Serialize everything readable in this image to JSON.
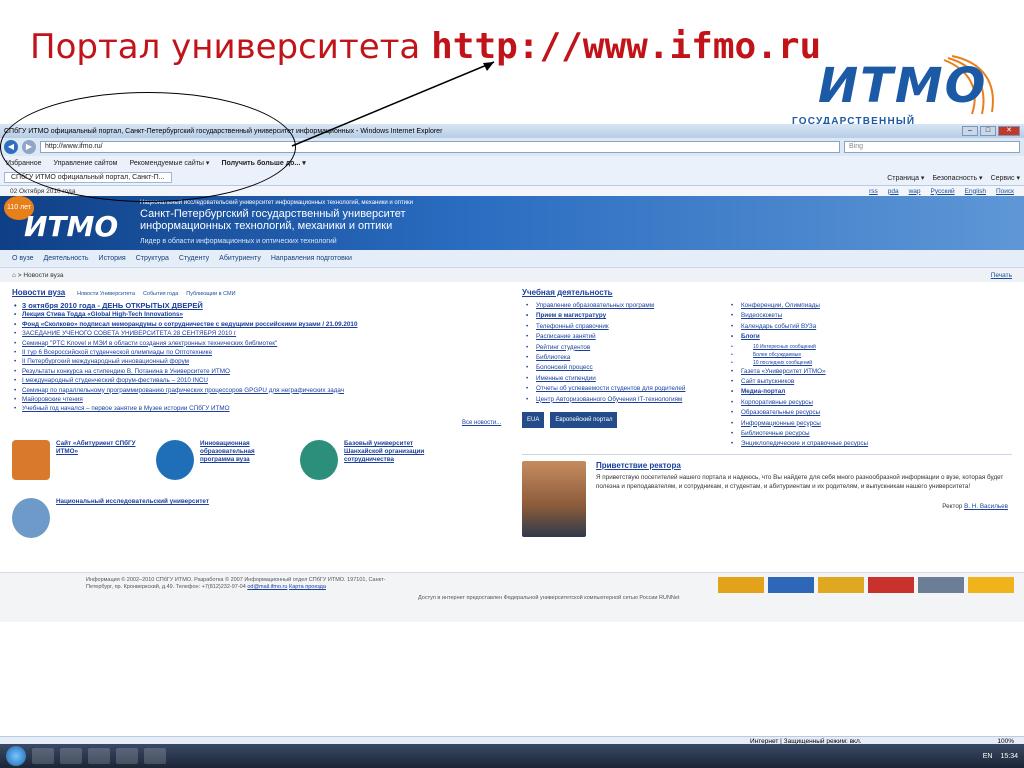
{
  "slide": {
    "title": "Портал университета",
    "url": "http://www.ifmo.ru",
    "logo_word": "ИТМО",
    "logo_sub": "ГОСУДАРСТВЕННЫЙ УНИВЕРСИТЕТ"
  },
  "browser": {
    "window_title": "СПбГУ ИТМО официальный портал, Санкт-Петербургский государственный университет информационных - Windows Internet Explorer",
    "address": "http://www.ifmo.ru/",
    "search_placeholder": "Bing",
    "favorites": [
      "Избранное",
      "Управление сайтом",
      "Рекомендуемые сайты ▾",
      "Получить больше до... ▾"
    ],
    "tab": "СПбГУ ИТМО официальный портал, Санкт-П...",
    "commands": [
      "Страница ▾",
      "Безопасность ▾",
      "Сервис ▾"
    ]
  },
  "site": {
    "date": "02 Октября 2010 года",
    "toplinks": [
      "rss",
      "pda",
      "wap",
      "Русский",
      "English",
      "Поиск"
    ],
    "anniv": "110 лет",
    "logo_small": "ИТМО",
    "uni_line1": "Национальный исследовательский университет информационных технологий, механики и оптики",
    "uni_line2": "Санкт-Петербургский государственный университет информационных технологий, механики и оптики",
    "motto": "Лидер в области информационных и оптических технологий",
    "nav": [
      "О вузе",
      "Деятельность",
      "История",
      "Структура",
      "Студенту",
      "Абитуриенту",
      "Направления подготовки"
    ],
    "breadcrumb": "Новости вуза",
    "print": "Печать",
    "news_heading": "Новости вуза",
    "news_tabs": [
      "Новости Университета",
      "События года",
      "Публикации в СМИ"
    ],
    "news": [
      "3 октября 2010 года - ДЕНЬ ОТКРЫТЫХ ДВЕРЕЙ",
      "Лекция Стива Тодда «Global High-Tech Innovations»",
      "Фонд «Сколково» подписал меморандумы о сотрудничестве с ведущими российскими вузами / 21.09.2010",
      "ЗАСЕДАНИЕ УЧЕНОГО СОВЕТА УНИВЕРСИТЕТА 28 СЕНТЯБРЯ 2010 г",
      "Семинар \"PTC Knovel и МЭИ в области создания электронных технических библиотек\"",
      "II тур 6 Всероссийской студенческой олимпиады по Оптотехнике",
      "II Петербургский международный инновационный форум",
      "Результаты конкурса на стипендию В. Потанина в Университете ИТМО",
      "I международный студенческий форум-фестиваль – 2010 INCU",
      "Семинар по параллельному программированию графических процессоров GPGPU для неграфических задач",
      "Майоровские чтения",
      "Учебный год начался – первое занятие в Музее истории СПбГУ ИТМО"
    ],
    "all_news": "Все новости...",
    "promos": [
      "Сайт «Абитуриент СПбГУ ИТМО»",
      "Инновационная образовательная программа вуза",
      "Базовый университет Шанхайской организации сотрудничества"
    ],
    "promo2": "Национальный исследовательский университет",
    "study_heading": "Учебная деятельность",
    "study_left": [
      "Управление образовательных программ",
      "Прием в магистратуру",
      "Телефонный справочник",
      "Расписание занятий",
      "Рейтинг студентов",
      "Библиотека",
      "Болонский процесс",
      "Именные стипендии",
      "Отчеты об успеваемости студентов для родителей",
      "Центр Авторизованного Обучения IT-технологиям"
    ],
    "study_right": [
      "Конференции, Олимпиады",
      "Видеосюжеты",
      "Календарь событий ВУЗа",
      "Блоги",
      "10 Интересных сообщений",
      "Более обсуждаемые",
      "10 последних сообщений",
      "Газета «Университет ИТМО»",
      "Сайт выпускников",
      "Медиа-портал",
      "Корпоративные ресурсы",
      "Образовательные ресурсы",
      "Информационные ресурсы",
      "Библиотечные ресурсы",
      "Энциклопедические и справочные ресурсы"
    ],
    "eua": [
      "EUA",
      "Европейский портал"
    ],
    "rector_title": "Приветствие ректора",
    "rector_text": "Я приветствую посетителей нашего портала и надеюсь, что Вы найдете для себя много разнообразной информации о вузе, которая будет полезна и преподавателям, и сотрудникам, и студентам, и абитуриентам и их родителям, и выпускникам нашего университета!",
    "rector_sign": "Ректор",
    "rector_name": "В. Н. Васильев",
    "footer_info": "Информация © 2002–2010 СПбГУ ИТМО. Разработка © 2007 Информационный отдел СПбГУ ИТМО. 197101, Санкт-Петербург, пр. Кронверкский, д.49. Телефон: +7(812)232-97-04",
    "footer_email": "od@mail.ifmo.ru",
    "footer_map": "Карта проезда",
    "footer_runnet": "Доступ в интернет предоставлен Федеральной университетской компьютерной сетью России RUNNet"
  },
  "status": {
    "zone": "Интернет | Защищенный режим: вкл.",
    "zoom": "100%",
    "lang": "EN",
    "clock": "15:34"
  }
}
